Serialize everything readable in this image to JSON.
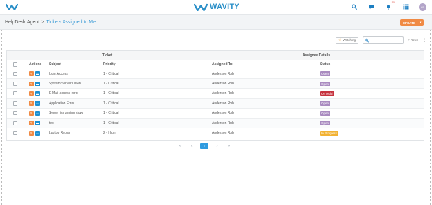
{
  "header": {
    "brand": "WAVITY",
    "notification_count": "10",
    "avatar_initials": "AR"
  },
  "breadcrumb": {
    "root": "HelpDesk Agent",
    "separator": ">",
    "current": "Tickets Assigned to Me"
  },
  "create_button": {
    "label": "CREATE",
    "caret": "▾"
  },
  "toolbar": {
    "watching_label": "Watching",
    "search_placeholder": "",
    "search_value": "",
    "rows_label": "7 Rows"
  },
  "table": {
    "group_headers": {
      "ticket": "Ticket",
      "assignee": "Assignee Details"
    },
    "columns": {
      "actions": "Actions",
      "subject": "Subject",
      "priority": "Priority",
      "assigned_to": "Assigned To",
      "status": "Status"
    },
    "rows": [
      {
        "subject": "login Access",
        "priority": "1 - Critical",
        "assigned_to": "Anderson Rob",
        "status": "Open",
        "status_color": "#a98bc0"
      },
      {
        "subject": "System Server Down",
        "priority": "1 - Critical",
        "assigned_to": "Anderson Rob",
        "status": "Open",
        "status_color": "#a98bc0"
      },
      {
        "subject": "E-Mail access error",
        "priority": "1 - Critical",
        "assigned_to": "Anderson Rob",
        "status": "On Hold",
        "status_color": "#c6343f"
      },
      {
        "subject": "Application Error",
        "priority": "1 - Critical",
        "assigned_to": "Anderson Rob",
        "status": "Open",
        "status_color": "#a98bc0"
      },
      {
        "subject": "Server is running slow",
        "priority": "1 - Critical",
        "assigned_to": "Anderson Rob",
        "status": "Open",
        "status_color": "#a98bc0"
      },
      {
        "subject": "test",
        "priority": "1 - Critical",
        "assigned_to": "Anderson Rob",
        "status": "Open",
        "status_color": "#a98bc0"
      },
      {
        "subject": "Laptop Repair",
        "priority": "2 - High",
        "assigned_to": "Anderson Rob",
        "status": "In Progress",
        "status_color": "#f2b233"
      }
    ]
  },
  "pagination": {
    "first": "«",
    "prev": "‹",
    "current": "1",
    "next": "›",
    "last": "»"
  },
  "colors": {
    "brand": "#2a8fc8",
    "accent_orange": "#f08a44",
    "accent_blue": "#1d8fd1"
  },
  "icons": {
    "logo": "wavity-logo-icon",
    "search": "search-icon",
    "chat": "chat-icon",
    "bell": "bell-icon",
    "apps": "grid-icon",
    "edit": "edit-icon",
    "view": "view-icon"
  }
}
